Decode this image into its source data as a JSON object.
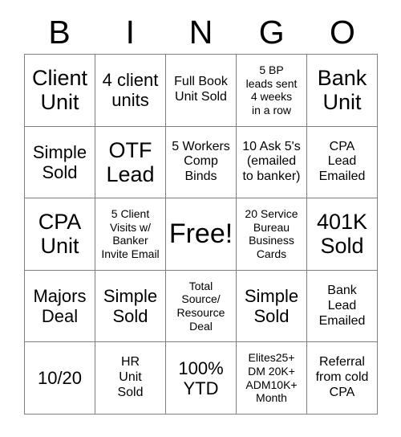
{
  "card": {
    "title": "BINGO Card",
    "header_letters": [
      "B",
      "I",
      "N",
      "G",
      "O"
    ],
    "grid_size": "5x5",
    "free_space_label": "Free!",
    "colors": {
      "background": "#ffffff",
      "text": "#000000",
      "grid_line": "#808080"
    },
    "rows": [
      {
        "cells": [
          {
            "text": "Client\nUnit",
            "size": "lg"
          },
          {
            "text": "4 client\nunits",
            "size": "md"
          },
          {
            "text": "Full Book\nUnit Sold",
            "size": "sm"
          },
          {
            "text": "5 BP\nleads sent\n4 weeks\nin a row",
            "size": "xs"
          },
          {
            "text": "Bank\nUnit",
            "size": "lg"
          }
        ]
      },
      {
        "cells": [
          {
            "text": "Simple\nSold",
            "size": "md"
          },
          {
            "text": "OTF\nLead",
            "size": "lg"
          },
          {
            "text": "5 Workers\nComp\nBinds",
            "size": "sm"
          },
          {
            "text": "10 Ask 5's\n(emailed\nto banker)",
            "size": "sm"
          },
          {
            "text": "CPA\nLead\nEmailed",
            "size": "sm"
          }
        ]
      },
      {
        "cells": [
          {
            "text": "CPA\nUnit",
            "size": "lg"
          },
          {
            "text": "5 Client\nVisits w/\nBanker\nInvite Email",
            "size": "xs"
          },
          {
            "text": "Free!",
            "size": "xl"
          },
          {
            "text": "20 Service\nBureau\nBusiness\nCards",
            "size": "xs"
          },
          {
            "text": "401K\nSold",
            "size": "lg"
          }
        ]
      },
      {
        "cells": [
          {
            "text": "Majors\nDeal",
            "size": "md"
          },
          {
            "text": "Simple\nSold",
            "size": "md"
          },
          {
            "text": "Total\nSource/\nResource\nDeal",
            "size": "xs"
          },
          {
            "text": "Simple\nSold",
            "size": "md"
          },
          {
            "text": "Bank\nLead\nEmailed",
            "size": "sm"
          }
        ]
      },
      {
        "cells": [
          {
            "text": "10/20",
            "size": "md"
          },
          {
            "text": "HR\nUnit\nSold",
            "size": "sm"
          },
          {
            "text": "100%\nYTD",
            "size": "md"
          },
          {
            "text": "Elites25+\nDM 20K+\nADM10K+\nMonth",
            "size": "xs"
          },
          {
            "text": "Referral\nfrom cold\nCPA",
            "size": "sm"
          }
        ]
      }
    ]
  }
}
